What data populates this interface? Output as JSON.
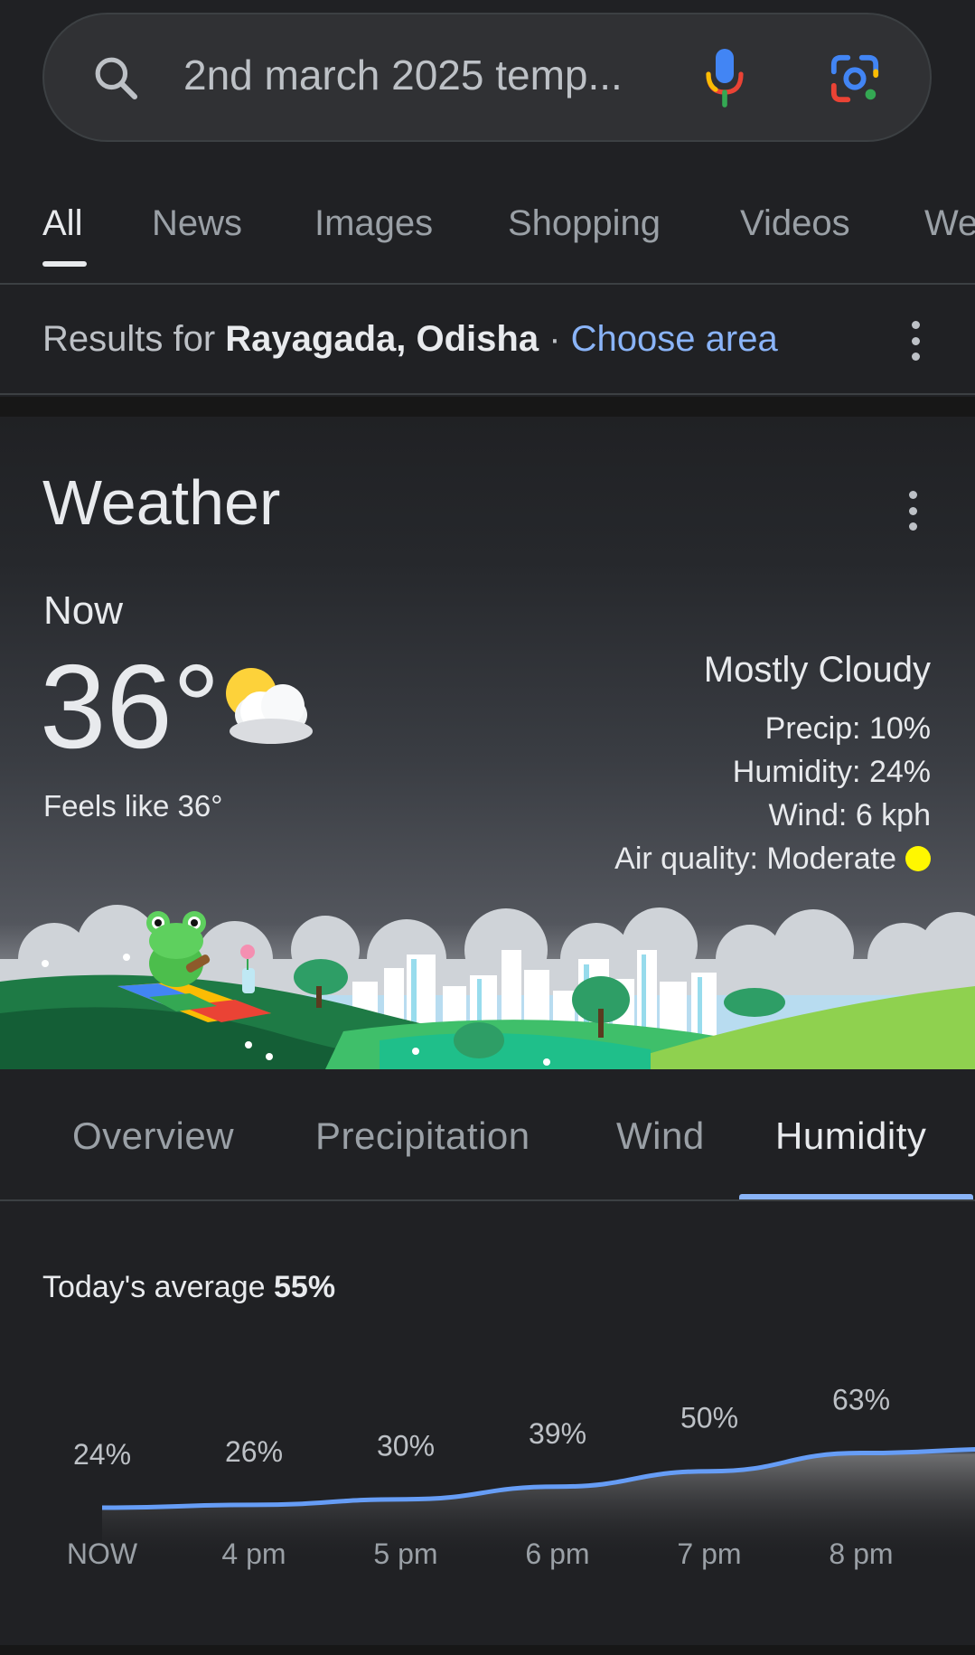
{
  "search": {
    "query": "2nd march 2025 temp..."
  },
  "icons": {
    "search": "search-icon",
    "mic": "mic-icon",
    "lens": "google-lens-icon",
    "more": "more-vert-icon",
    "condition": "mostly-cloudy-icon"
  },
  "tabs": [
    {
      "label": "All",
      "active": true
    },
    {
      "label": "News"
    },
    {
      "label": "Images"
    },
    {
      "label": "Shopping"
    },
    {
      "label": "Videos"
    },
    {
      "label": "We"
    }
  ],
  "location": {
    "prefix": "Results for",
    "place": "Rayagada, Odisha",
    "separator": "·",
    "choose_area": "Choose area"
  },
  "weather": {
    "title": "Weather",
    "now_label": "Now",
    "temperature": "36°",
    "feels_like": "Feels like 36°",
    "condition": "Mostly Cloudy",
    "precip_label": "Precip:",
    "precip_value": "10%",
    "humidity_label": "Humidity:",
    "humidity_value": "24%",
    "wind_label": "Wind:",
    "wind_value": "6 kph",
    "air_quality_label": "Air quality:",
    "air_quality_value": "Moderate",
    "air_quality_color": "#fff700"
  },
  "weather_tabs": [
    {
      "label": "Overview"
    },
    {
      "label": "Precipitation"
    },
    {
      "label": "Wind"
    },
    {
      "label": "Humidity",
      "active": true
    }
  ],
  "humidity": {
    "average_label": "Today's average",
    "average_value": "55%"
  },
  "chart_data": {
    "type": "area",
    "categories": [
      "NOW",
      "4 pm",
      "5 pm",
      "6 pm",
      "7 pm",
      "8 pm",
      ""
    ],
    "values": [
      24,
      26,
      30,
      39,
      50,
      63,
      66
    ],
    "labels": [
      "24%",
      "26%",
      "30%",
      "39%",
      "50%",
      "63%",
      ""
    ],
    "ylim": [
      0,
      100
    ],
    "line_color": "#669df6",
    "grid": false
  },
  "colors": {
    "background": "#202124",
    "accent": "#8ab4f8",
    "text": "#e8eaed",
    "muted": "#9aa0a6"
  }
}
